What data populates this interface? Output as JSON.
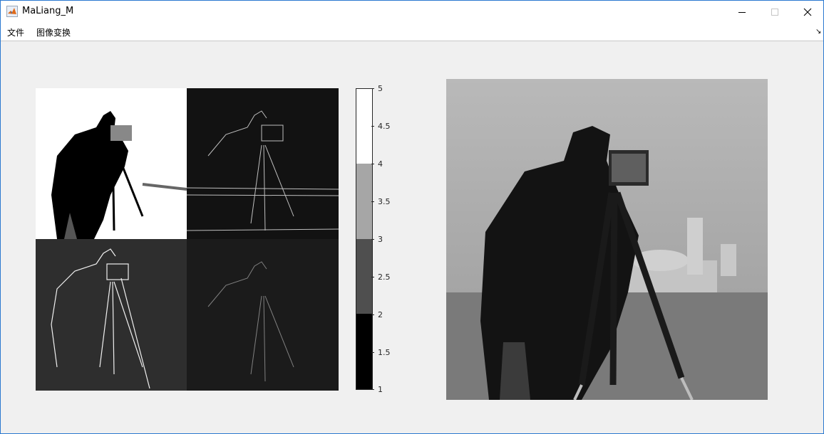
{
  "window": {
    "title": "MaLiang_M",
    "controls": [
      "minimize",
      "maximize",
      "close"
    ]
  },
  "menu": {
    "items": [
      "文件",
      "图像变换"
    ]
  },
  "colorbar": {
    "ticks": [
      "5",
      "4.5",
      "4",
      "3.5",
      "3",
      "2.5",
      "2",
      "1.5",
      "1"
    ],
    "levels": [
      {
        "value": 1,
        "color": "#000000"
      },
      {
        "value": 2,
        "color": "#4f4f4f"
      },
      {
        "value": 3,
        "color": "#a6a6a6"
      },
      {
        "value": 4,
        "color": "#ffffff"
      }
    ]
  },
  "colors": {
    "titlebar": "#ffffff",
    "background": "#f0f0f0",
    "border": "#2b79d0"
  }
}
